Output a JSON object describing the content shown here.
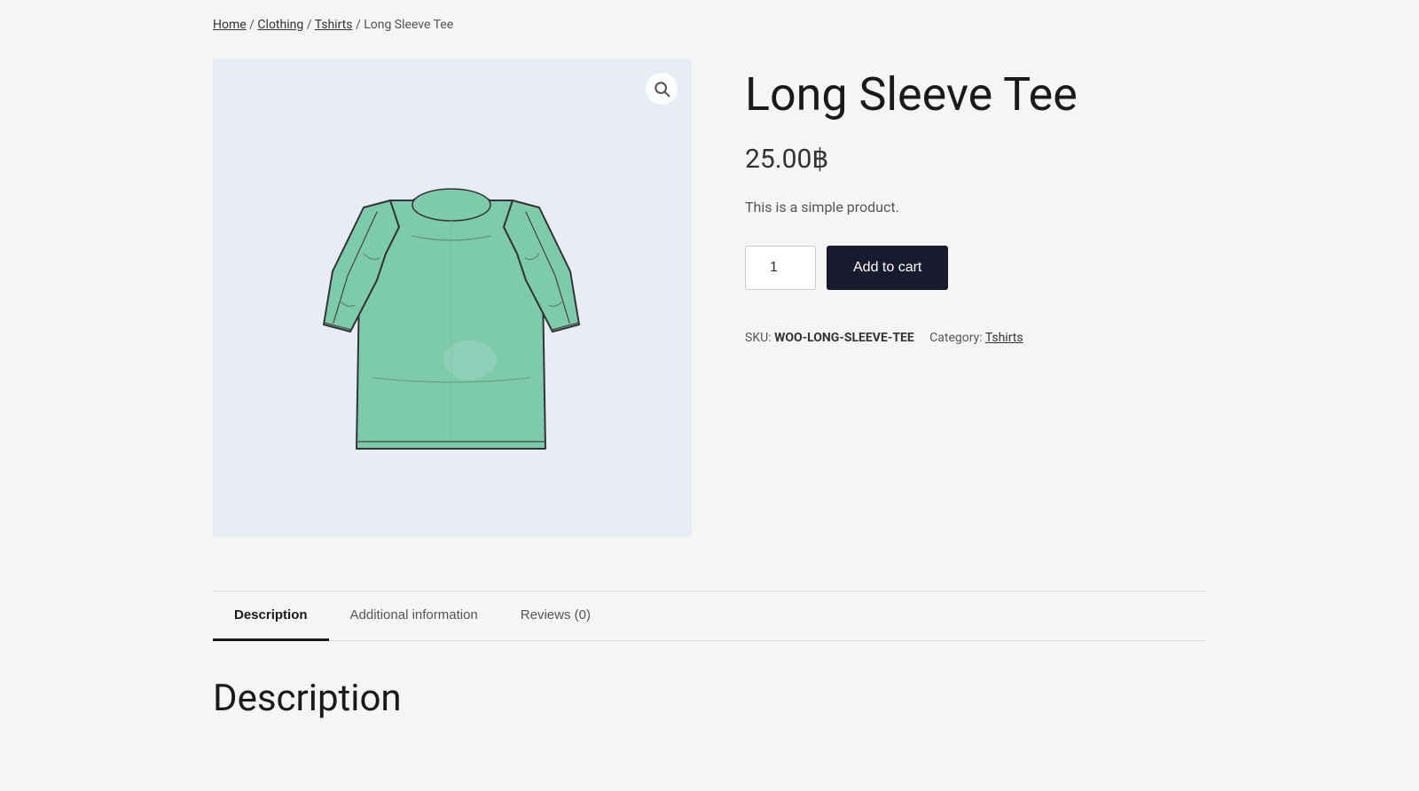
{
  "breadcrumb": {
    "home": "Home",
    "clothing": "Clothing",
    "tshirts": "Tshirts",
    "current": "Long Sleeve Tee"
  },
  "product": {
    "title": "Long Sleeve Tee",
    "price": "25.00฿",
    "description": "This is a simple product.",
    "quantity_default": "1",
    "add_to_cart_label": "Add to cart",
    "sku_label": "SKU:",
    "sku_value": "WOO-LONG-SLEEVE-TEE",
    "category_label": "Category:",
    "category_value": "Tshirts"
  },
  "tabs": {
    "tab1": "Description",
    "tab2": "Additional information",
    "tab3": "Reviews (0)",
    "active_tab_content_title": "Description"
  },
  "icons": {
    "zoom": "🔍",
    "search": "⌕"
  }
}
